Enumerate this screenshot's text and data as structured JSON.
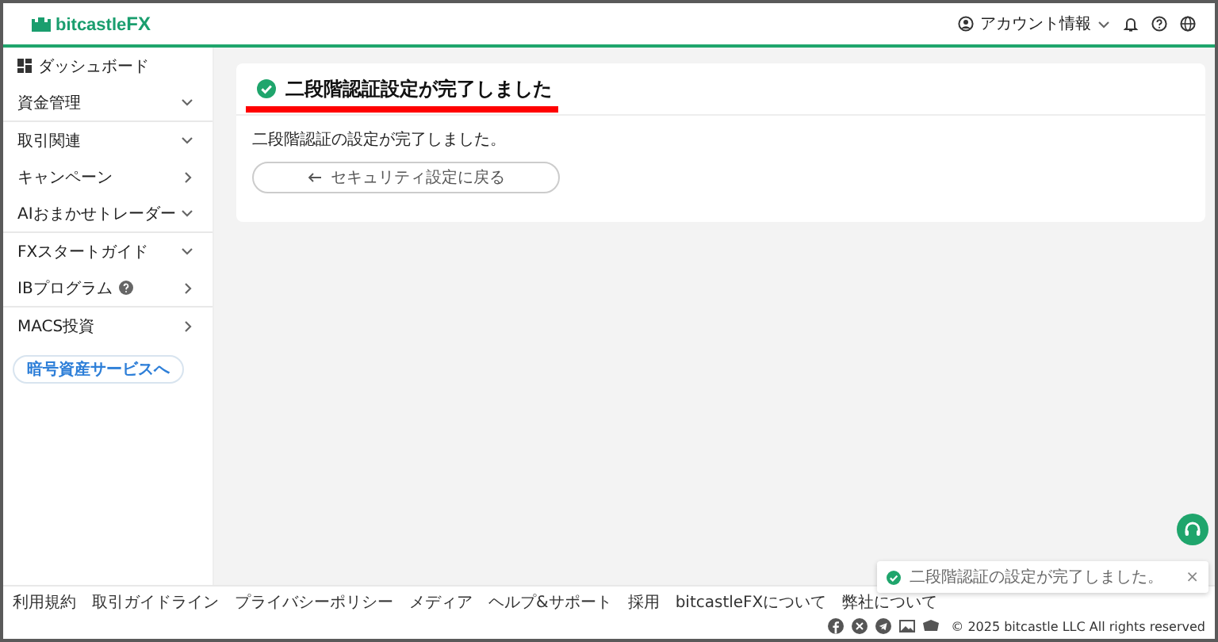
{
  "header": {
    "logo": {
      "text": "bitcastle",
      "accent": "FX"
    },
    "account_label": "アカウント情報"
  },
  "sidebar": {
    "items": [
      {
        "label": "ダッシュボード",
        "kind": "dashboard",
        "divider": false
      },
      {
        "label": "資金管理",
        "kind": "expand",
        "divider": true
      },
      {
        "label": "取引関連",
        "kind": "expand",
        "divider": false
      },
      {
        "label": "キャンペーン",
        "kind": "link",
        "divider": false
      },
      {
        "label": "AIおまかせトレーダー",
        "kind": "expand",
        "divider": true
      },
      {
        "label": "FXスタートガイド",
        "kind": "expand",
        "divider": false
      },
      {
        "label": "IBプログラム",
        "kind": "help",
        "divider": true
      },
      {
        "label": "MACS投資",
        "kind": "link",
        "divider": false
      }
    ],
    "button": "暗号資産サービスへ"
  },
  "card": {
    "title": "二段階認証設定が完了しました",
    "underlined": true,
    "message": "二段階認証の設定が完了しました。",
    "back_button": "セキュリティ設定に戻る"
  },
  "footer": {
    "links": [
      "利用規約",
      "取引ガイドライン",
      "プライバシーポリシー",
      "メディア",
      "ヘルプ&サポート",
      "採用",
      "bitcastleFXについて",
      "弊社について"
    ],
    "copyright": "© 2025 bitcastle LLC All rights reserved"
  },
  "toast": {
    "message": "二段階認証の設定が完了しました。",
    "close": "×"
  }
}
